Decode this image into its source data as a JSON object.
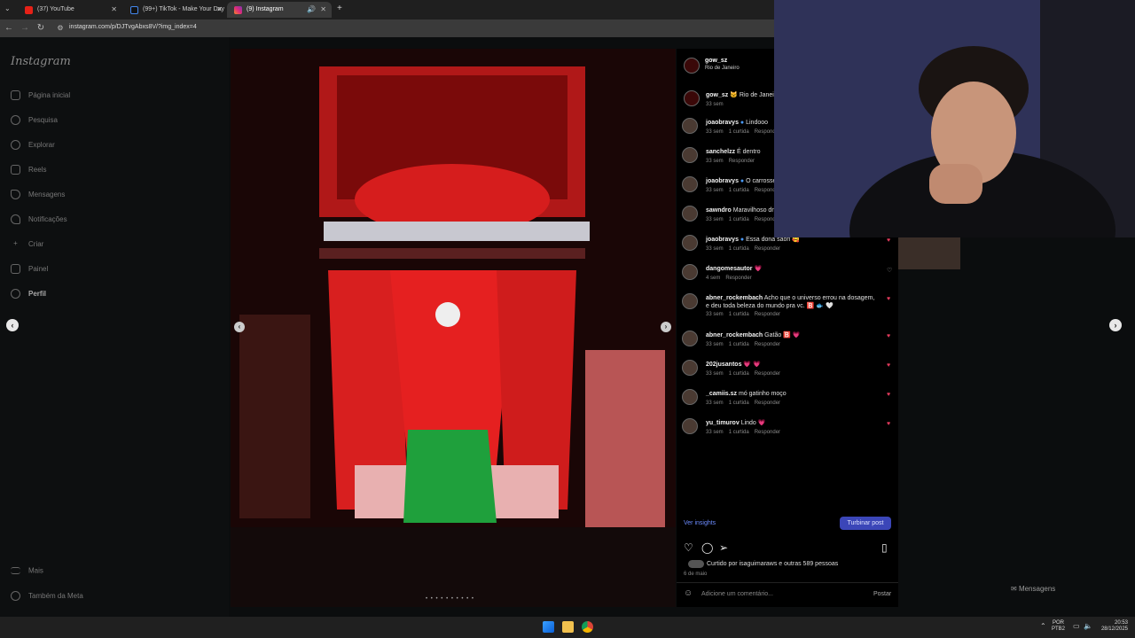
{
  "browser": {
    "tabs": [
      {
        "label": "(37) YouTube",
        "icon": "youtube-icon",
        "active": false
      },
      {
        "label": "(99+) TikTok - Make Your Day",
        "icon": "tiktok-icon",
        "active": false
      },
      {
        "label": "(9) Instagram",
        "icon": "instagram-icon",
        "active": true
      }
    ],
    "new_tab": "+",
    "url": "instagram.com/p/DJTvgAbxs8V/?img_index=4"
  },
  "sidebar": {
    "logo": "Instagram",
    "items": [
      {
        "label": "Página inicial",
        "icon": "home-icon"
      },
      {
        "label": "Pesquisa",
        "icon": "search-icon"
      },
      {
        "label": "Explorar",
        "icon": "compass-icon"
      },
      {
        "label": "Reels",
        "icon": "reels-icon"
      },
      {
        "label": "Mensagens",
        "icon": "messages-icon"
      },
      {
        "label": "Notificações",
        "icon": "heart-icon"
      },
      {
        "label": "Criar",
        "icon": "plus-icon"
      },
      {
        "label": "Painel",
        "icon": "dashboard-icon"
      },
      {
        "label": "Perfil",
        "icon": "profile-icon"
      }
    ],
    "bottom": [
      {
        "label": "Mais",
        "icon": "menu-icon"
      },
      {
        "label": "Também da Meta",
        "icon": "meta-icon"
      }
    ]
  },
  "post": {
    "author": "gow_sz",
    "location": "Rio de Janeiro",
    "caption_user": "gow_sz",
    "caption_text": "🐱 Rio de Janeiro",
    "caption_time": "33 sem"
  },
  "comments": [
    {
      "user": "joaobravys",
      "verified": true,
      "text": "Lindooo",
      "time": "33 sem",
      "likes": "1 curtida",
      "reply": "Responder",
      "heart": true
    },
    {
      "user": "sanchelzz",
      "verified": false,
      "text": "É dentro",
      "time": "33 sem",
      "likes": "",
      "reply": "Responder",
      "heart": false
    },
    {
      "user": "joaobravys",
      "verified": true,
      "text": "O carrosse",
      "time": "33 sem",
      "likes": "1 curtida",
      "reply": "Responder",
      "heart": false
    },
    {
      "user": "sawndro",
      "verified": false,
      "text": "Maravilhoso dn",
      "time": "33 sem",
      "likes": "1 curtida",
      "reply": "Responder",
      "heart": false
    },
    {
      "user": "joaobravys",
      "verified": true,
      "text": "Essa dona saori 🥰",
      "time": "33 sem",
      "likes": "1 curtida",
      "reply": "Responder",
      "heart": true
    },
    {
      "user": "dangomesautor",
      "verified": false,
      "text": "💗",
      "time": "4 sem",
      "likes": "",
      "reply": "Responder",
      "heart": false
    },
    {
      "user": "abner_rockembach",
      "verified": false,
      "text": "Acho que o universo errou na dosagem, e deu toda beleza do mundo pra vc. 🅱️ 🐟 🤍",
      "time": "33 sem",
      "likes": "1 curtida",
      "reply": "Responder",
      "heart": true
    },
    {
      "user": "abner_rockembach",
      "verified": false,
      "text": "Gatão 🅱️ 💗",
      "time": "33 sem",
      "likes": "1 curtida",
      "reply": "Responder",
      "heart": true
    },
    {
      "user": "202jusantos",
      "verified": false,
      "text": "💗 💗",
      "time": "33 sem",
      "likes": "1 curtida",
      "reply": "Responder",
      "heart": true
    },
    {
      "user": "_camiis.sz",
      "verified": false,
      "text": "mó gatinho moço",
      "time": "33 sem",
      "likes": "1 curtida",
      "reply": "Responder",
      "heart": true
    },
    {
      "user": "yu_timurov",
      "verified": false,
      "text": "Lindo 💗",
      "time": "33 sem",
      "likes": "1 curtida",
      "reply": "Responder",
      "heart": true
    }
  ],
  "actions": {
    "insights": "Ver insights",
    "boost": "Turbinar post",
    "liked_by": "Curtido por isaguimaraws e outras 589 pessoas",
    "date": "6 de maio",
    "add_comment": "Adicione um comentário...",
    "post": "Postar"
  },
  "messages_label": "Mensagens",
  "taskbar": {
    "lang_1": "POR",
    "lang_2": "PTB2",
    "time": "20:53",
    "date": "28/12/2025"
  },
  "colors": {
    "accent_blue": "#3b46b8",
    "link_blue": "#6d8cff",
    "heart_red": "#e23a5c"
  }
}
